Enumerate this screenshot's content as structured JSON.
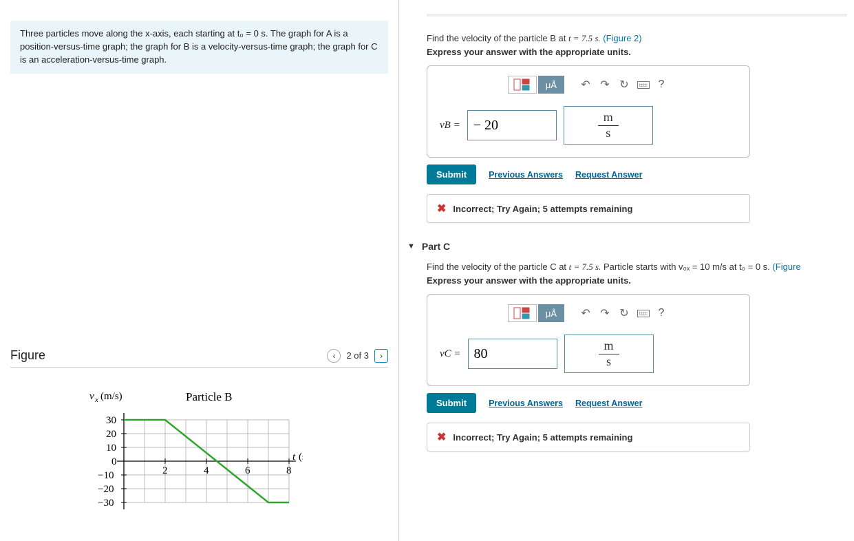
{
  "problem": {
    "text": "Three particles move along the x-axis, each starting at t₀ = 0 s. The graph for A is a position-versus-time graph; the graph for B is a velocity-versus-time graph; the graph for C is an acceleration-versus-time graph."
  },
  "figure": {
    "title": "Figure",
    "pager": "2 of 3"
  },
  "chart_data": {
    "type": "line",
    "title": "Particle B",
    "xlabel": "t (s)",
    "ylabel": "vₓ (m/s)",
    "xlim": [
      0,
      8
    ],
    "ylim": [
      -30,
      30
    ],
    "xticks": [
      2,
      4,
      6,
      8
    ],
    "yticks": [
      -30,
      -20,
      -10,
      0,
      10,
      20,
      30
    ],
    "series": [
      {
        "name": "Particle B",
        "color": "#2fa52f",
        "points": [
          [
            0,
            30
          ],
          [
            2,
            30
          ],
          [
            7,
            -30
          ],
          [
            8,
            -30
          ]
        ]
      }
    ]
  },
  "toolbar": {
    "ua_label": "μÅ",
    "help_label": "?"
  },
  "partB": {
    "question_prefix": "Find the velocity of the particle B at ",
    "question_t": "t = 7.5 s.",
    "figlink": "(Figure 2)",
    "instruction": "Express your answer with the appropriate units.",
    "var": "vB =",
    "value": "− 20",
    "unit_num": "m",
    "unit_den": "s",
    "submit": "Submit",
    "prev": "Previous Answers",
    "req": "Request Answer",
    "feedback": "Incorrect; Try Again; 5 attempts remaining"
  },
  "partC": {
    "header": "Part C",
    "question_prefix": "Find the velocity of the particle C at ",
    "question_t": "t = 7.5 s.",
    "question_suffix": " Particle starts with v₀ₓ = 10 m/s at t₀ = 0 s. ",
    "figlink": "(Figure",
    "instruction": "Express your answer with the appropriate units.",
    "var": "vC =",
    "value": "80",
    "unit_num": "m",
    "unit_den": "s",
    "submit": "Submit",
    "prev": "Previous Answers",
    "req": "Request Answer",
    "feedback": "Incorrect; Try Again; 5 attempts remaining"
  }
}
